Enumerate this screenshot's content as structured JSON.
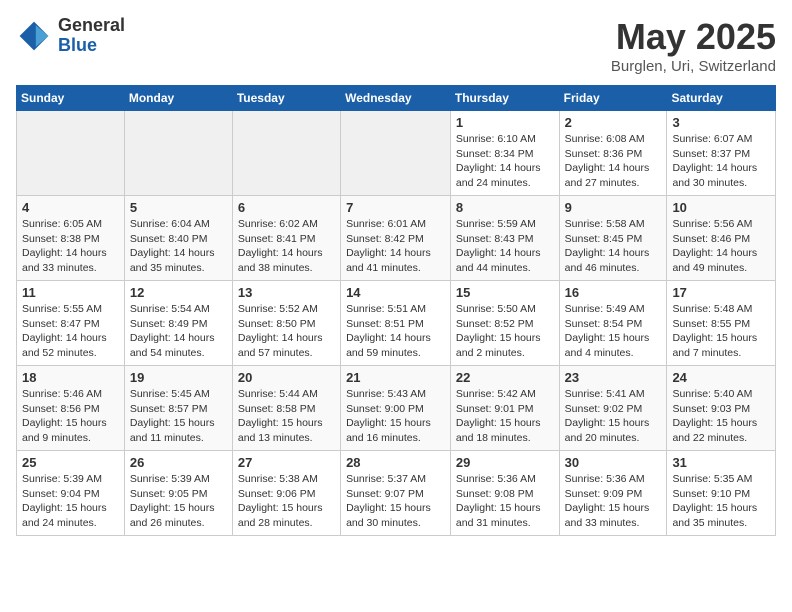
{
  "header": {
    "logo_general": "General",
    "logo_blue": "Blue",
    "title": "May 2025",
    "subtitle": "Burglen, Uri, Switzerland"
  },
  "weekdays": [
    "Sunday",
    "Monday",
    "Tuesday",
    "Wednesday",
    "Thursday",
    "Friday",
    "Saturday"
  ],
  "weeks": [
    [
      {
        "day": "",
        "detail": ""
      },
      {
        "day": "",
        "detail": ""
      },
      {
        "day": "",
        "detail": ""
      },
      {
        "day": "",
        "detail": ""
      },
      {
        "day": "1",
        "detail": "Sunrise: 6:10 AM\nSunset: 8:34 PM\nDaylight: 14 hours\nand 24 minutes."
      },
      {
        "day": "2",
        "detail": "Sunrise: 6:08 AM\nSunset: 8:36 PM\nDaylight: 14 hours\nand 27 minutes."
      },
      {
        "day": "3",
        "detail": "Sunrise: 6:07 AM\nSunset: 8:37 PM\nDaylight: 14 hours\nand 30 minutes."
      }
    ],
    [
      {
        "day": "4",
        "detail": "Sunrise: 6:05 AM\nSunset: 8:38 PM\nDaylight: 14 hours\nand 33 minutes."
      },
      {
        "day": "5",
        "detail": "Sunrise: 6:04 AM\nSunset: 8:40 PM\nDaylight: 14 hours\nand 35 minutes."
      },
      {
        "day": "6",
        "detail": "Sunrise: 6:02 AM\nSunset: 8:41 PM\nDaylight: 14 hours\nand 38 minutes."
      },
      {
        "day": "7",
        "detail": "Sunrise: 6:01 AM\nSunset: 8:42 PM\nDaylight: 14 hours\nand 41 minutes."
      },
      {
        "day": "8",
        "detail": "Sunrise: 5:59 AM\nSunset: 8:43 PM\nDaylight: 14 hours\nand 44 minutes."
      },
      {
        "day": "9",
        "detail": "Sunrise: 5:58 AM\nSunset: 8:45 PM\nDaylight: 14 hours\nand 46 minutes."
      },
      {
        "day": "10",
        "detail": "Sunrise: 5:56 AM\nSunset: 8:46 PM\nDaylight: 14 hours\nand 49 minutes."
      }
    ],
    [
      {
        "day": "11",
        "detail": "Sunrise: 5:55 AM\nSunset: 8:47 PM\nDaylight: 14 hours\nand 52 minutes."
      },
      {
        "day": "12",
        "detail": "Sunrise: 5:54 AM\nSunset: 8:49 PM\nDaylight: 14 hours\nand 54 minutes."
      },
      {
        "day": "13",
        "detail": "Sunrise: 5:52 AM\nSunset: 8:50 PM\nDaylight: 14 hours\nand 57 minutes."
      },
      {
        "day": "14",
        "detail": "Sunrise: 5:51 AM\nSunset: 8:51 PM\nDaylight: 14 hours\nand 59 minutes."
      },
      {
        "day": "15",
        "detail": "Sunrise: 5:50 AM\nSunset: 8:52 PM\nDaylight: 15 hours\nand 2 minutes."
      },
      {
        "day": "16",
        "detail": "Sunrise: 5:49 AM\nSunset: 8:54 PM\nDaylight: 15 hours\nand 4 minutes."
      },
      {
        "day": "17",
        "detail": "Sunrise: 5:48 AM\nSunset: 8:55 PM\nDaylight: 15 hours\nand 7 minutes."
      }
    ],
    [
      {
        "day": "18",
        "detail": "Sunrise: 5:46 AM\nSunset: 8:56 PM\nDaylight: 15 hours\nand 9 minutes."
      },
      {
        "day": "19",
        "detail": "Sunrise: 5:45 AM\nSunset: 8:57 PM\nDaylight: 15 hours\nand 11 minutes."
      },
      {
        "day": "20",
        "detail": "Sunrise: 5:44 AM\nSunset: 8:58 PM\nDaylight: 15 hours\nand 13 minutes."
      },
      {
        "day": "21",
        "detail": "Sunrise: 5:43 AM\nSunset: 9:00 PM\nDaylight: 15 hours\nand 16 minutes."
      },
      {
        "day": "22",
        "detail": "Sunrise: 5:42 AM\nSunset: 9:01 PM\nDaylight: 15 hours\nand 18 minutes."
      },
      {
        "day": "23",
        "detail": "Sunrise: 5:41 AM\nSunset: 9:02 PM\nDaylight: 15 hours\nand 20 minutes."
      },
      {
        "day": "24",
        "detail": "Sunrise: 5:40 AM\nSunset: 9:03 PM\nDaylight: 15 hours\nand 22 minutes."
      }
    ],
    [
      {
        "day": "25",
        "detail": "Sunrise: 5:39 AM\nSunset: 9:04 PM\nDaylight: 15 hours\nand 24 minutes."
      },
      {
        "day": "26",
        "detail": "Sunrise: 5:39 AM\nSunset: 9:05 PM\nDaylight: 15 hours\nand 26 minutes."
      },
      {
        "day": "27",
        "detail": "Sunrise: 5:38 AM\nSunset: 9:06 PM\nDaylight: 15 hours\nand 28 minutes."
      },
      {
        "day": "28",
        "detail": "Sunrise: 5:37 AM\nSunset: 9:07 PM\nDaylight: 15 hours\nand 30 minutes."
      },
      {
        "day": "29",
        "detail": "Sunrise: 5:36 AM\nSunset: 9:08 PM\nDaylight: 15 hours\nand 31 minutes."
      },
      {
        "day": "30",
        "detail": "Sunrise: 5:36 AM\nSunset: 9:09 PM\nDaylight: 15 hours\nand 33 minutes."
      },
      {
        "day": "31",
        "detail": "Sunrise: 5:35 AM\nSunset: 9:10 PM\nDaylight: 15 hours\nand 35 minutes."
      }
    ]
  ]
}
